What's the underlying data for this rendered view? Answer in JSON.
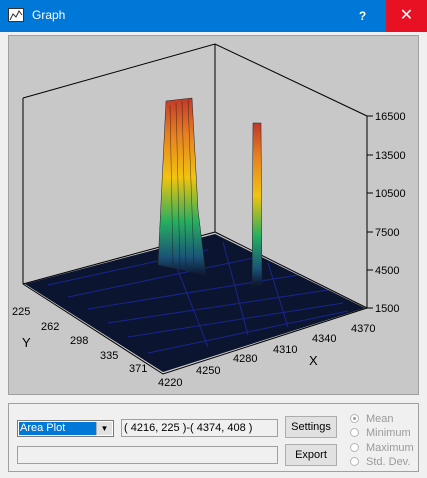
{
  "window": {
    "title": "Graph",
    "help_label": "?",
    "close_label": "✕"
  },
  "plot": {
    "z_ticks": [
      "16500",
      "13500",
      "10500",
      "7500",
      "4500",
      "1500"
    ],
    "x_ticks": [
      "4250",
      "4280",
      "4310",
      "4340",
      "4370"
    ],
    "y_ticks": [
      "225",
      "262",
      "298",
      "335",
      "371",
      "4220"
    ],
    "x_label": "X",
    "y_label": "Y"
  },
  "controls": {
    "plot_type": "Area Plot",
    "range_text": "( 4216, 225 )-( 4374, 408 )",
    "status_text": "",
    "settings_label": "Settings",
    "export_label": "Export",
    "stats": [
      "Mean",
      "Minimum",
      "Maximum",
      "Std. Dev."
    ]
  }
}
